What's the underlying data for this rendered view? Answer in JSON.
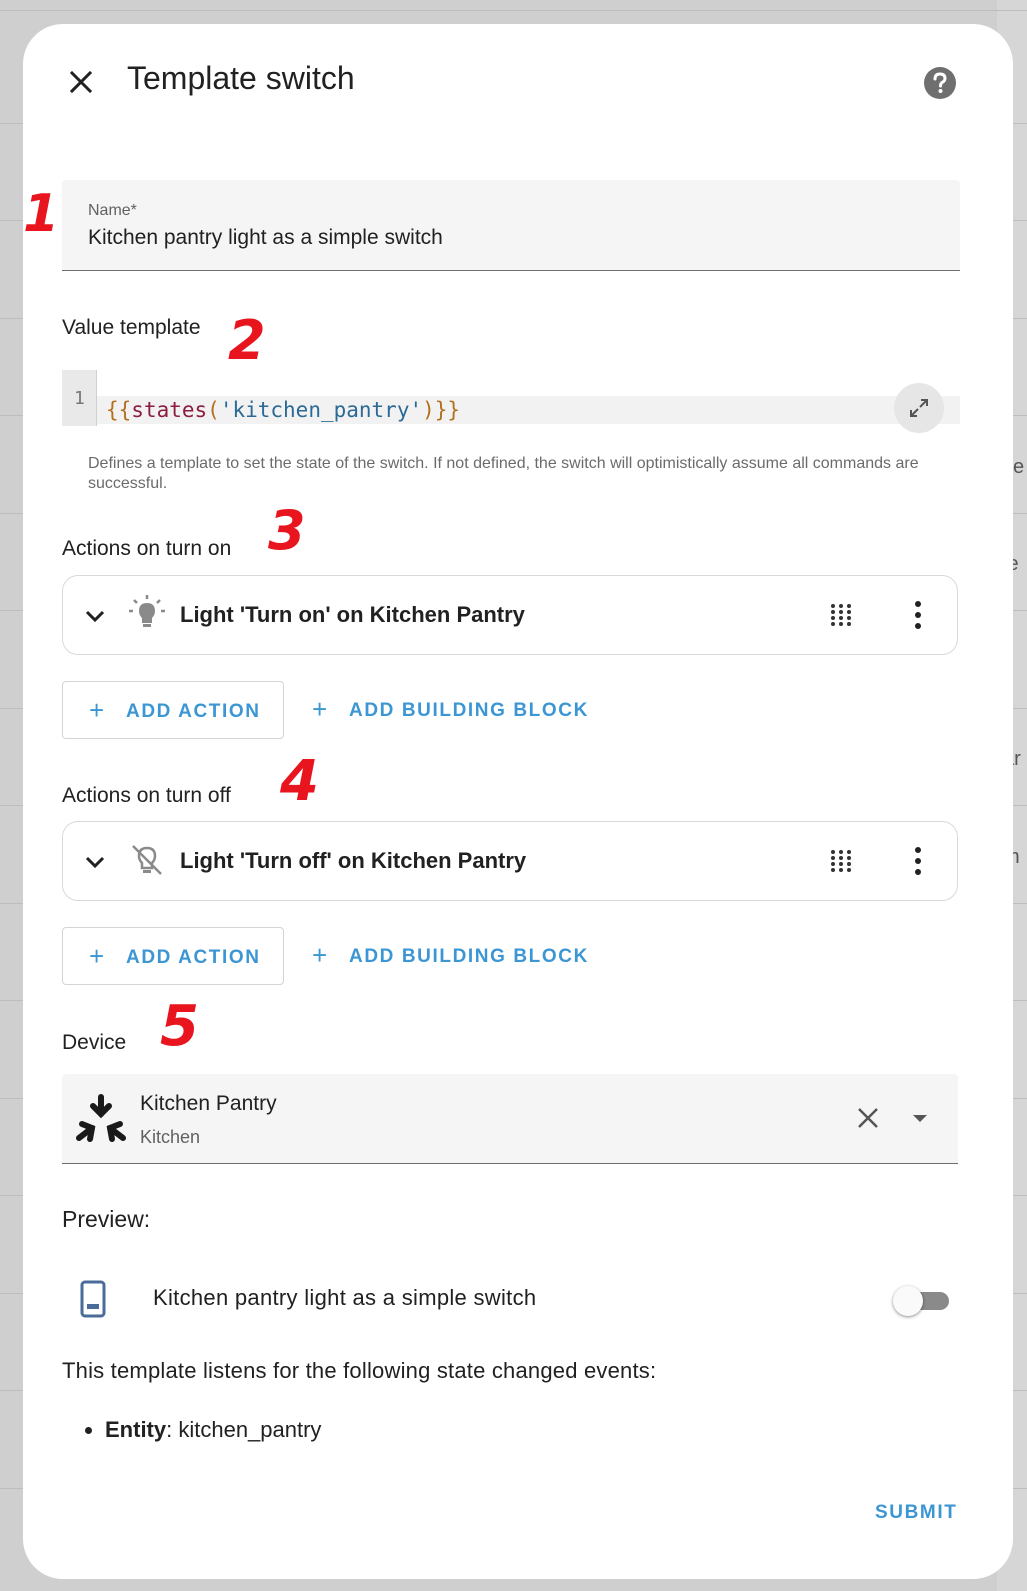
{
  "dialog": {
    "title": "Template switch",
    "close_icon": "close-icon",
    "help_icon": "help-circle-icon"
  },
  "annotations": [
    "1",
    "2",
    "3",
    "4",
    "5"
  ],
  "name_field": {
    "label": "Name*",
    "value": "Kitchen pantry light as a simple switch"
  },
  "value_template": {
    "label": "Value template",
    "line_number": "1",
    "code_tokens": [
      "{{",
      "states",
      "(",
      "'kitchen_pantry'",
      ")",
      "}}"
    ],
    "helper": "Defines a template to set the state of the switch. If not defined, the switch will optimistically assume all commands are successful."
  },
  "turn_on": {
    "label": "Actions on turn on",
    "action_label": "Light 'Turn on' on Kitchen Pantry",
    "action_icon": "lightbulb-on-icon",
    "add_action": "ADD ACTION",
    "add_block": "ADD BUILDING BLOCK"
  },
  "turn_off": {
    "label": "Actions on turn off",
    "action_label": "Light 'Turn off' on Kitchen Pantry",
    "action_icon": "lightbulb-off-icon",
    "add_action": "ADD ACTION",
    "add_block": "ADD BUILDING BLOCK"
  },
  "device": {
    "label": "Device",
    "name": "Kitchen Pantry",
    "area": "Kitchen",
    "logo_icon": "matter-logo-icon"
  },
  "preview": {
    "label": "Preview:",
    "entity_name": "Kitchen pantry light as a simple switch",
    "entity_icon": "phone-icon",
    "toggle_state": "off",
    "listen_text": "This template listens for the following state changed events:",
    "entity_key": "Entity",
    "entity_value": ": kitchen_pantry"
  },
  "footer": {
    "submit": "SUBMIT"
  },
  "background_fragments": [
    "ite",
    "le",
    "ar",
    "m"
  ],
  "colors": {
    "accent": "#3c96d3",
    "annotation": "#e8141e",
    "code_punct": "#b3701e",
    "code_func": "#8b1e3f",
    "code_string": "#2b6a96"
  }
}
